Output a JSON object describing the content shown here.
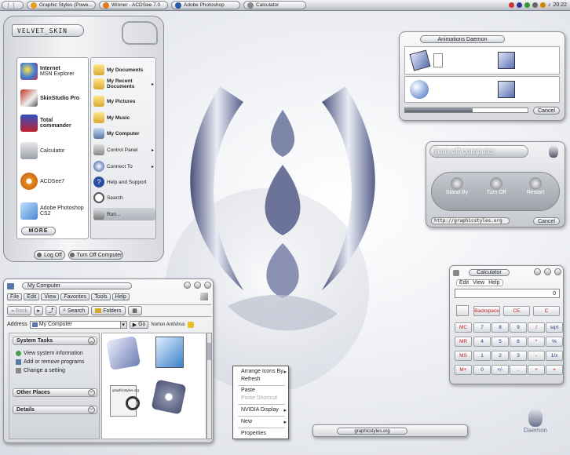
{
  "taskbar": {
    "start_label": "",
    "tasks": [
      {
        "label": "Graphic Styles (Powe...",
        "color": "#e8a020"
      },
      {
        "label": "Winner - ACDSee 7.0",
        "color": "#e07820"
      },
      {
        "label": "Adobe Photoshop",
        "color": "#2a5aa8"
      },
      {
        "label": "Calculator",
        "color": "#888888"
      }
    ],
    "clock": "20:22"
  },
  "start_menu": {
    "user": "VELVET_SKIN",
    "pinned": [
      {
        "label": "Internet",
        "sub": "MSN Explorer",
        "icon": "msn-icon",
        "color": "#3a7ad8"
      },
      {
        "label": "SkinStudio Pro",
        "sub": "",
        "icon": "skinstudio-icon",
        "color": "#c03020"
      },
      {
        "label": "Total",
        "sub": "commander",
        "icon": "floppy-icon",
        "color": "#3050c0"
      },
      {
        "label": "Calculator",
        "sub": "",
        "icon": "calculator-icon",
        "color": "#9aa0a8"
      },
      {
        "label": "ACDSee7",
        "sub": "",
        "icon": "acdsee-icon",
        "color": "#e88a20"
      },
      {
        "label": "Adobe Photoshop",
        "sub": "CS2",
        "icon": "photoshop-icon",
        "color": "#4a8ad0"
      }
    ],
    "places": [
      {
        "label": "My Documents",
        "bold": true,
        "arrow": false,
        "icon": "folder-icon"
      },
      {
        "label": "My Recent Documents",
        "bold": true,
        "arrow": true,
        "icon": "recent-folder-icon"
      },
      {
        "label": "My Pictures",
        "bold": true,
        "arrow": false,
        "icon": "pictures-folder-icon"
      },
      {
        "label": "My Music",
        "bold": true,
        "arrow": false,
        "icon": "music-folder-icon"
      },
      {
        "label": "My Computer",
        "bold": true,
        "arrow": false,
        "icon": "computer-icon"
      },
      {
        "label": "Control Panel",
        "bold": false,
        "arrow": true,
        "icon": "control-panel-icon"
      },
      {
        "label": "Connect To",
        "bold": false,
        "arrow": true,
        "icon": "connect-icon"
      },
      {
        "label": "Help and Support",
        "bold": false,
        "arrow": false,
        "icon": "help-icon"
      },
      {
        "label": "Search",
        "bold": false,
        "arrow": false,
        "icon": "search-icon"
      },
      {
        "label": "Run...",
        "bold": false,
        "arrow": false,
        "icon": "run-icon"
      }
    ],
    "more_label": "MORE",
    "logoff_label": "Log Off",
    "turnoff_label": "Turn Off Computer"
  },
  "animations": {
    "title": "Animations  Daemon",
    "cancel": "Cancel",
    "progress": 0.55
  },
  "turnoff": {
    "title": "Turn off computer",
    "standby": "Stand By",
    "turnoff": "Turn Off",
    "restart": "Restart",
    "url": "http://graphicstyles.org",
    "cancel": "Cancel"
  },
  "calculator": {
    "title": "Calculator",
    "menu": [
      "Edit",
      "View",
      "Help"
    ],
    "display": "0",
    "top_keys": [
      "Backspace",
      "CE",
      "C"
    ],
    "mem_keys": [
      "MC",
      "MR",
      "MS",
      "M+"
    ],
    "rows": [
      [
        "7",
        "8",
        "9",
        "/",
        "sqrt"
      ],
      [
        "4",
        "5",
        "6",
        "*",
        "%"
      ],
      [
        "1",
        "2",
        "3",
        "-",
        "1/x"
      ],
      [
        "0",
        "+/-",
        ".",
        "+",
        "="
      ]
    ]
  },
  "explorer": {
    "title": "My Computer",
    "menu": [
      "File",
      "Edit",
      "View",
      "Favorites",
      "Tools",
      "Help"
    ],
    "back": "Back",
    "search": "Search",
    "folders": "Folders",
    "address_label": "Address",
    "address_value": "My Computer",
    "go": "Go",
    "antivirus": "Norton AntiVirus",
    "system_tasks": "System Tasks",
    "tasks": [
      "View system information",
      "Add or remove programs",
      "Change a setting"
    ],
    "other_places": "Other Places",
    "details": "Details",
    "file_label": "graphicstyles.org"
  },
  "context_menu": {
    "items": [
      {
        "label": "Arrange Icons By",
        "arrow": true,
        "disabled": false
      },
      {
        "label": "Refresh",
        "arrow": false,
        "disabled": false
      },
      {
        "label": "Paste",
        "arrow": false,
        "disabled": false
      },
      {
        "label": "Paste Shortcut",
        "arrow": false,
        "disabled": true
      },
      {
        "label": "NVIDIA Display",
        "arrow": true,
        "disabled": false
      },
      {
        "label": "New",
        "arrow": true,
        "disabled": false
      },
      {
        "label": "Properties",
        "arrow": false,
        "disabled": false
      }
    ]
  },
  "floating_bar": {
    "label": "graphicstyles.org"
  },
  "watermark": {
    "label": "Daemon"
  }
}
